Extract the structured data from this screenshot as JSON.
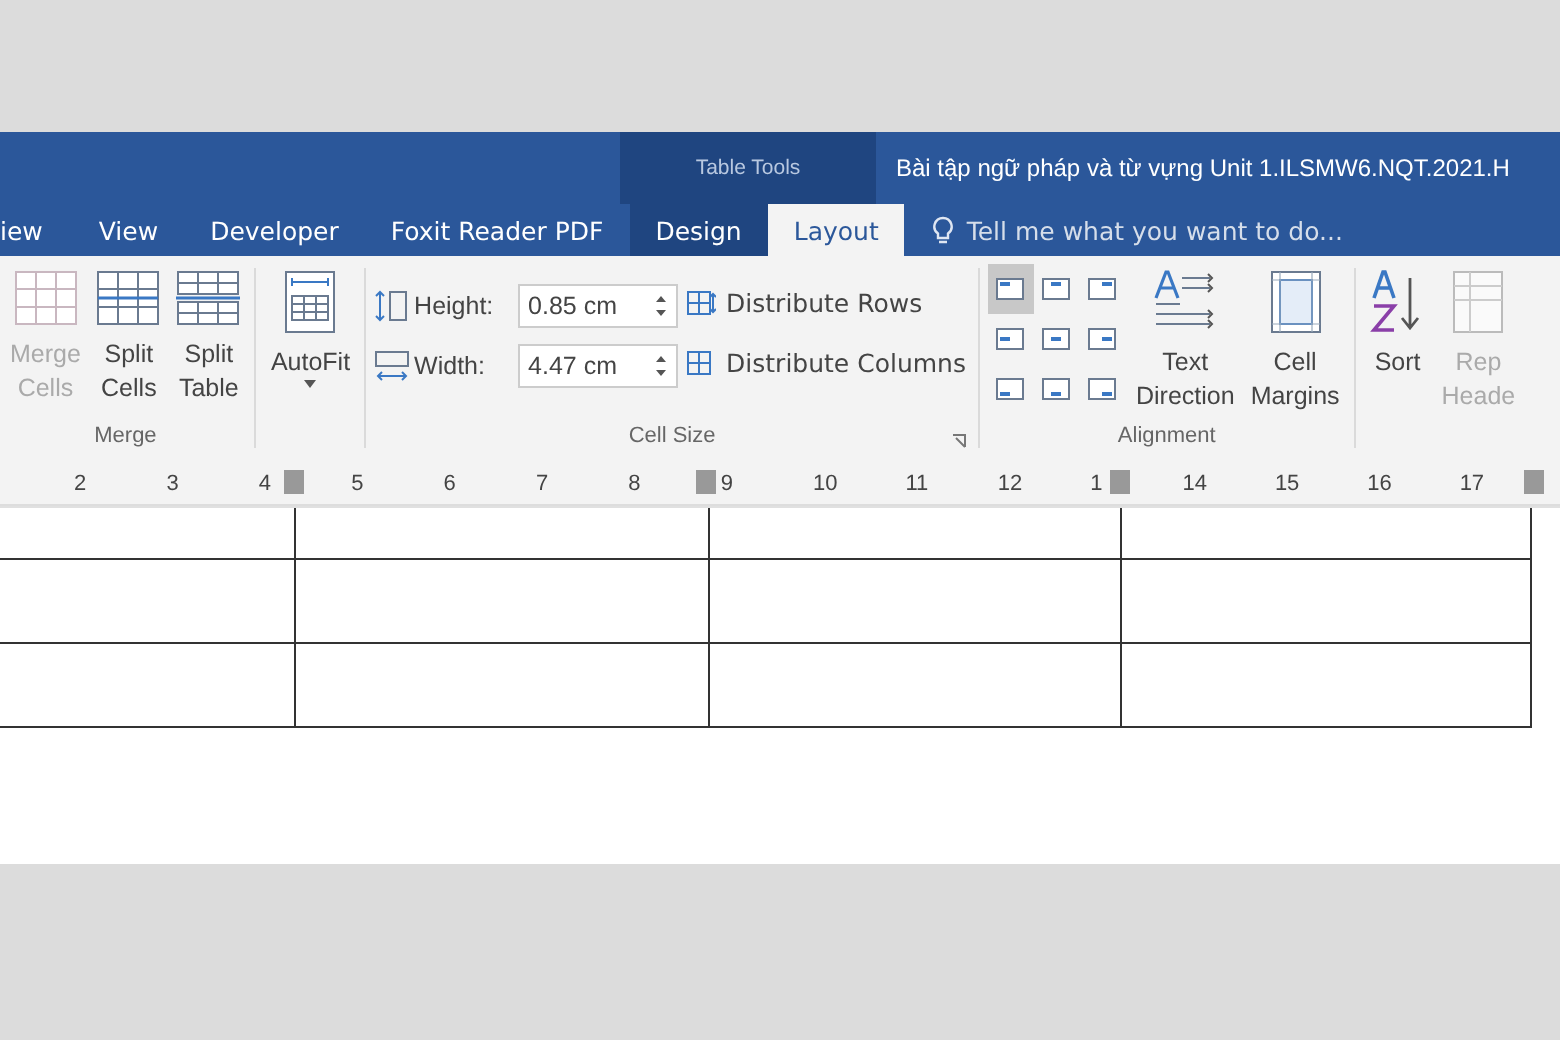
{
  "title_bar": {
    "contextual_label": "Table Tools",
    "document_title": "Bài tập ngữ pháp và từ vựng Unit 1.ILSMW6.NQT.2021.H"
  },
  "tabs": [
    {
      "label": "iew",
      "selected": false,
      "contextual": false
    },
    {
      "label": "View",
      "selected": false,
      "contextual": false
    },
    {
      "label": "Developer",
      "selected": false,
      "contextual": false
    },
    {
      "label": "Foxit Reader PDF",
      "selected": false,
      "contextual": false
    },
    {
      "label": "Design",
      "selected": false,
      "contextual": true
    },
    {
      "label": "Layout",
      "selected": true,
      "contextual": true
    }
  ],
  "tell_me": {
    "placeholder": "Tell me what you want to do..."
  },
  "merge_group": {
    "label": "Merge",
    "buttons": [
      {
        "kind": "merge",
        "lines": [
          "Merge",
          "Cells"
        ],
        "disabled": true
      },
      {
        "kind": "split-cells",
        "lines": [
          "Split",
          "Cells"
        ],
        "disabled": false
      },
      {
        "kind": "split-table",
        "lines": [
          "Split",
          "Table"
        ],
        "disabled": false
      }
    ]
  },
  "autofit": {
    "label": "AutoFit"
  },
  "cell_size_group": {
    "label": "Cell Size",
    "fields": [
      {
        "kind": "height",
        "label": "Height:",
        "value": "0.85 cm"
      },
      {
        "kind": "width",
        "label": "Width:",
        "value": "4.47 cm"
      }
    ],
    "distribute": [
      {
        "kind": "rows",
        "label": "Distribute Rows"
      },
      {
        "kind": "columns",
        "label": "Distribute Columns"
      }
    ]
  },
  "alignment_group": {
    "label": "Alignment",
    "align_buttons": [
      {
        "selected": true
      },
      {
        "selected": false
      },
      {
        "selected": false
      },
      {
        "selected": false
      },
      {
        "selected": false
      },
      {
        "selected": false
      },
      {
        "selected": false
      },
      {
        "selected": false
      },
      {
        "selected": false
      }
    ],
    "buttons": [
      {
        "kind": "text-direction",
        "lines": [
          "Text",
          "Direction"
        ]
      },
      {
        "kind": "cell-margins",
        "lines": [
          "Cell",
          "Margins"
        ]
      }
    ]
  },
  "data_group": {
    "buttons": [
      {
        "kind": "sort",
        "lines": [
          "Sort"
        ],
        "disabled": false
      },
      {
        "kind": "repeat",
        "lines": [
          "Rep",
          "Heade"
        ],
        "disabled": true
      }
    ]
  },
  "ruler": {
    "labels": [
      "2",
      "3",
      "4",
      "5",
      "6",
      "7",
      "8",
      "9",
      "10",
      "11",
      "12",
      "1",
      "14",
      "15",
      "16",
      "17"
    ]
  }
}
